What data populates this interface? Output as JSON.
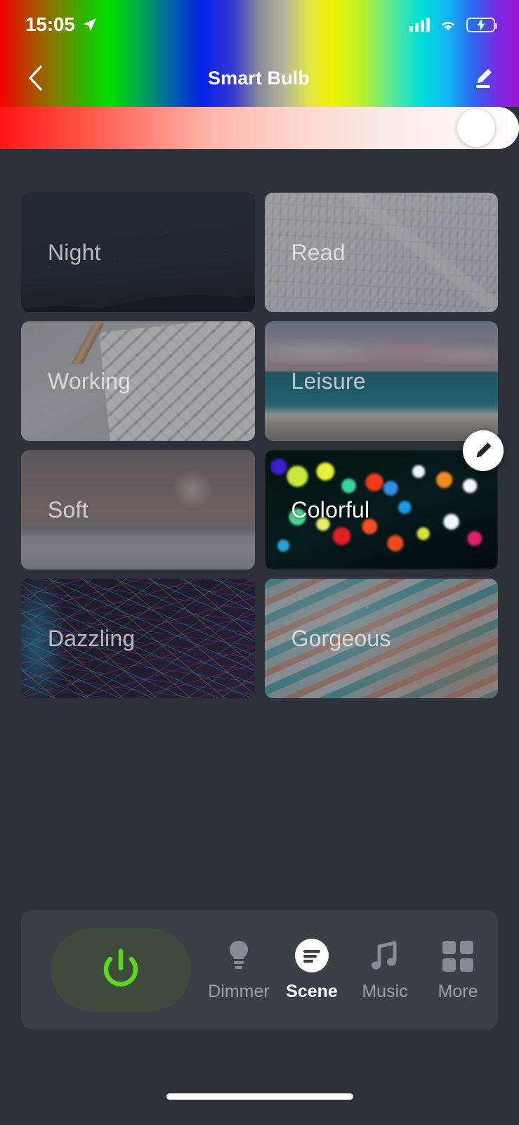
{
  "status_bar": {
    "time": "15:05",
    "location_icon": "location-arrow-icon",
    "cellular_icon": "cellular-signal-icon",
    "wifi_icon": "wifi-icon",
    "battery_icon": "battery-charging-icon",
    "battery_charging": true
  },
  "nav": {
    "back_icon": "chevron-left-icon",
    "title": "Smart Bulb",
    "edit_icon": "pencil-edit-icon"
  },
  "color_header": {
    "gradient": "rainbow-hue-spectrum",
    "saturation_slider": {
      "name": "saturation-slider",
      "value_percent": 95,
      "track_from": "#ff1414",
      "track_to": "#ffffff",
      "thumb_color": "#ffffff"
    }
  },
  "scenes": {
    "selected": "Colorful",
    "edit_fab_icon": "pencil-icon",
    "items": [
      {
        "label": "Night",
        "art": "art-night",
        "active": false
      },
      {
        "label": "Read",
        "art": "art-read",
        "active": false
      },
      {
        "label": "Working",
        "art": "art-working",
        "active": false
      },
      {
        "label": "Leisure",
        "art": "art-leisure",
        "active": false
      },
      {
        "label": "Soft",
        "art": "art-soft",
        "active": false
      },
      {
        "label": "Colorful",
        "art": "art-colorful",
        "active": true
      },
      {
        "label": "Dazzling",
        "art": "art-dazzling",
        "active": false
      },
      {
        "label": "Gorgeous",
        "art": "art-gorgeous",
        "active": false
      }
    ]
  },
  "bottom_bar": {
    "power": {
      "name": "power-button",
      "icon": "power-icon",
      "color": "#5dd71e",
      "pill_color": "#3e4a3c",
      "state": "on"
    },
    "tabs": [
      {
        "label": "Dimmer",
        "icon": "lightbulb-icon",
        "active": false
      },
      {
        "label": "Scene",
        "icon": "scene-lines-icon",
        "active": true
      },
      {
        "label": "Music",
        "icon": "music-note-icon",
        "active": false
      },
      {
        "label": "More",
        "icon": "grid-squares-icon",
        "active": false
      }
    ],
    "panel_color": "#3a3f48"
  },
  "theme": {
    "background": "#2d313a",
    "accent_green": "#5dd71e",
    "inactive_text": "#9aa0a8",
    "active_text": "#ffffff"
  },
  "home_indicator": "home-indicator-bar"
}
